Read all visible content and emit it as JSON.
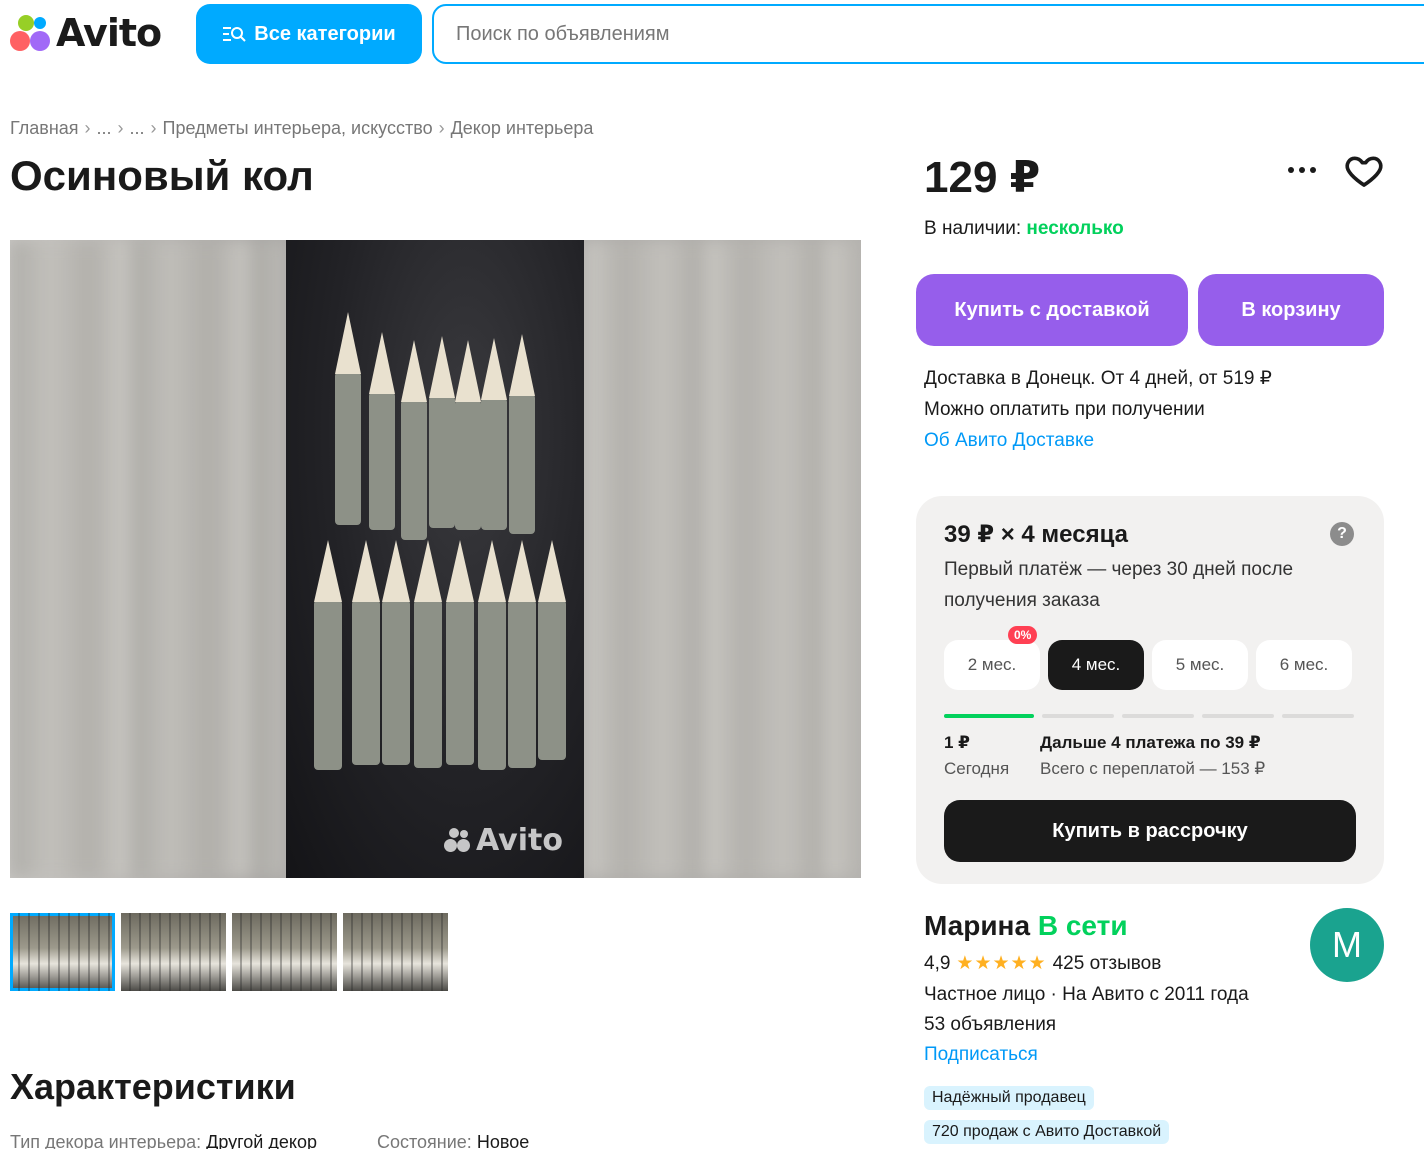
{
  "header": {
    "logo_text": "Avito",
    "categories_button": "Все категории",
    "search_placeholder": "Поиск по объявлениям"
  },
  "breadcrumb": [
    "Главная",
    "...",
    "...",
    "Предметы интерьера, искусство",
    "Декор интерьера"
  ],
  "title": "Осиновый кол",
  "gallery": {
    "watermark": "Avito",
    "thumbnails_count": 4
  },
  "characteristics": {
    "heading": "Характеристики",
    "items": [
      {
        "key": "Тип декора интерьера:",
        "value": "Другой декор"
      },
      {
        "key": "Состояние:",
        "value": "Новое"
      }
    ]
  },
  "price": {
    "value": "129 ₽",
    "stock_label": "В наличии:",
    "stock_value": "несколько"
  },
  "actions": {
    "buy_delivery": "Купить с доставкой",
    "add_to_cart": "В корзину"
  },
  "delivery": {
    "line1": "Доставка в Донецк. От 4 дней, от 519 ₽",
    "line2": "Можно оплатить при получении",
    "link": "Об Авито Доставке"
  },
  "installment": {
    "title": "39 ₽ × 4 месяца",
    "desc": "Первый платёж — через 30 дней после получения заказа",
    "zero_badge": "0%",
    "months": [
      "2 мес.",
      "4 мес.",
      "5 мес.",
      "6 мес."
    ],
    "selected_month": "4 мес.",
    "first_amount": "1 ₽",
    "first_label": "Сегодня",
    "next_payments": "Дальше 4 платежа по 39 ₽",
    "total": "Всего с переплатой — 153 ₽",
    "button": "Купить в рассрочку"
  },
  "seller": {
    "name": "Марина",
    "status": "В сети",
    "avatar_letter": "M",
    "rating": "4,9",
    "stars": "★★★★★",
    "reviews": "425 отзывов",
    "type_line": "Частное лицо · На Авито с 2011 года",
    "ads": "53 объявления",
    "subscribe": "Подписаться",
    "badges": [
      "Надёжный продавец",
      "720 продаж с Авито Доставкой"
    ]
  },
  "colors": {
    "accent_blue": "#00aaff",
    "purple_button": "#965eeb",
    "green_online": "#02d15c",
    "link_blue": "#0099f7"
  }
}
